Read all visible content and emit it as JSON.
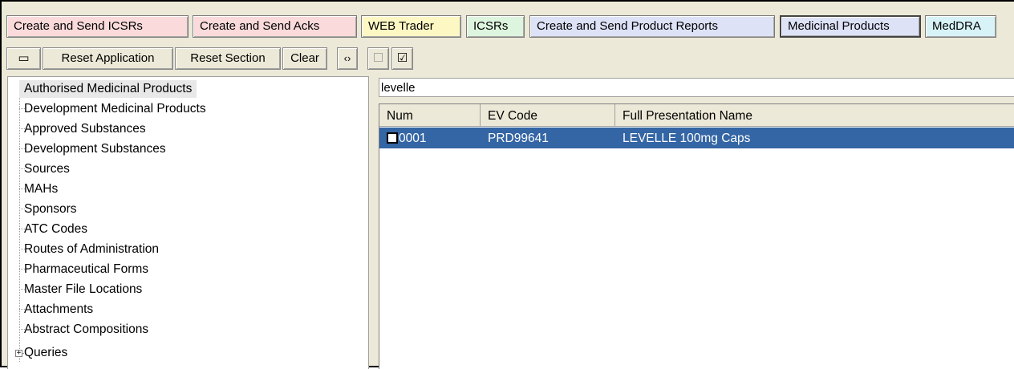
{
  "tabs": [
    {
      "label": "Create and Send ICSRs",
      "color": "#fadada"
    },
    {
      "label": "Create and Send Acks",
      "color": "#fadada"
    },
    {
      "label": "WEB Trader",
      "color": "#fdf7c3"
    },
    {
      "label": "ICSRs",
      "color": "#ddf5de"
    },
    {
      "label": "Create and Send Product Reports",
      "color": "#dde2f7"
    },
    {
      "label": "Medicinal Products",
      "color": "#dde2f7"
    },
    {
      "label": "MedDRA",
      "color": "#d7f3f7"
    }
  ],
  "toolbar": {
    "window_icon": "▭",
    "reset_application": "Reset Application",
    "reset_section": "Reset Section",
    "clear": "Clear",
    "refresh_icon": "‹›",
    "unchecked_icon": "☐",
    "checked_icon": "☑"
  },
  "tree": {
    "items": [
      "Authorised Medicinal Products",
      "Development Medicinal Products",
      "Approved Substances",
      "Development Substances",
      "Sources",
      "MAHs",
      "Sponsors",
      "ATC Codes",
      "Routes of Administration",
      "Pharmaceutical Forms",
      "Master File Locations",
      "Attachments",
      "Abstract Compositions",
      "Queries"
    ],
    "expander_symbol": "+"
  },
  "search": {
    "value": "levelle"
  },
  "grid": {
    "columns": [
      "Num",
      "EV Code",
      "Full Presentation Name"
    ],
    "rows": [
      {
        "num": "0001",
        "ev_code": "PRD99641",
        "name": "LEVELLE 100mg Caps"
      }
    ],
    "selected_row_color": "#3465a4"
  }
}
